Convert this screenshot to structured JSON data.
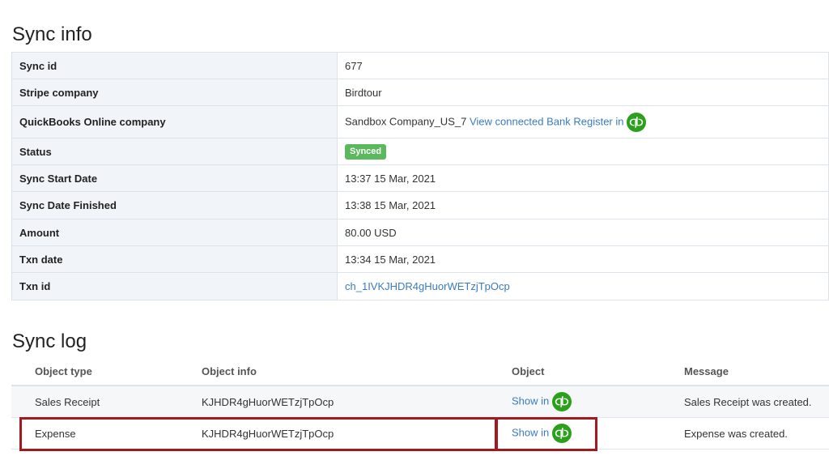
{
  "sync_info": {
    "title": "Sync info",
    "rows": [
      {
        "key": "Sync id",
        "value": "677"
      },
      {
        "key": "Stripe company",
        "value": "Birdtour"
      },
      {
        "key": "QuickBooks Online company",
        "value": "Sandbox Company_US_7",
        "link": "View connected Bank Register in"
      },
      {
        "key": "Status",
        "badge": "Synced"
      },
      {
        "key": "Sync Start Date",
        "value": "13:37 15 Mar, 2021"
      },
      {
        "key": "Sync Date Finished",
        "value": "13:38 15 Mar, 2021"
      },
      {
        "key": "Amount",
        "value": "80.00 USD"
      },
      {
        "key": "Txn date",
        "value": "13:34 15 Mar, 2021"
      },
      {
        "key": "Txn id",
        "link": "ch_1IVKJHDR4gHuorWETzjTpOcp"
      }
    ]
  },
  "sync_log": {
    "title": "Sync log",
    "headers": [
      "Object type",
      "Object info",
      "Object",
      "Message"
    ],
    "rows": [
      {
        "type": "Sales Receipt",
        "info": "KJHDR4gHuorWETzjTpOcp",
        "object_link": "Show in",
        "message": "Sales Receipt was created."
      },
      {
        "type": "Expense",
        "info": "KJHDR4gHuorWETzjTpOcp",
        "object_link": "Show in",
        "message": "Expense was created."
      }
    ]
  },
  "colors": {
    "qb_green": "#2ca01c",
    "badge_green": "#5cb85c",
    "link_blue": "#3a7bbf",
    "highlight_red": "#a3191f"
  },
  "icons": {
    "quickbooks": "quickbooks-icon"
  }
}
